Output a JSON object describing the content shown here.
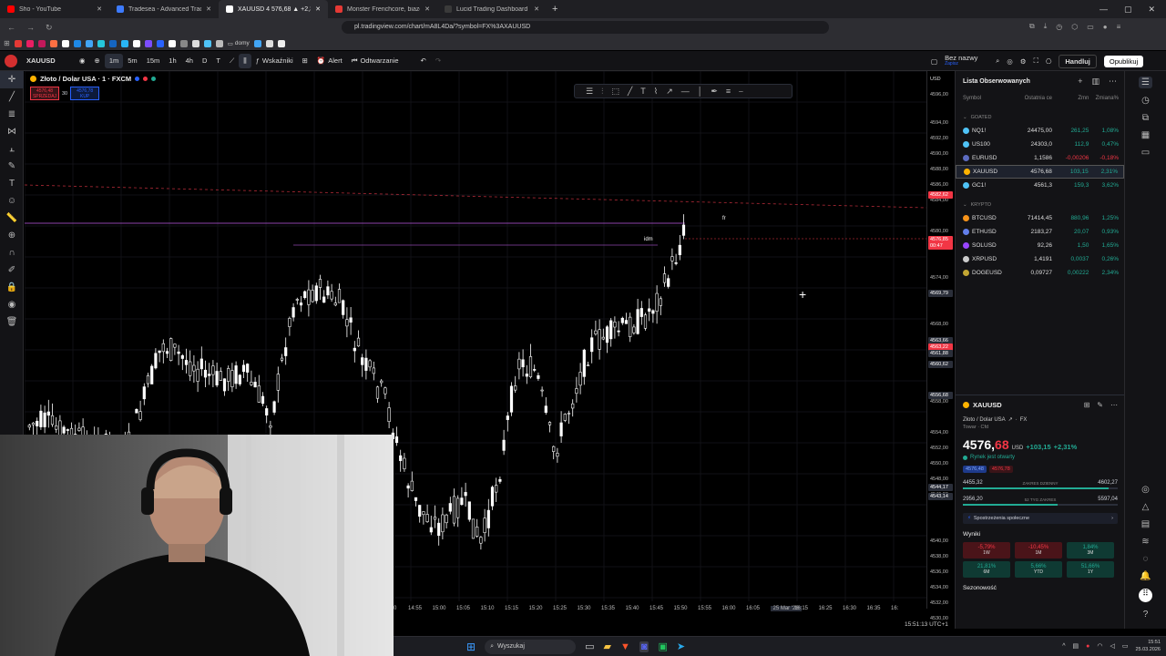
{
  "browser": {
    "tabs": [
      {
        "label": "Sho - YouTube",
        "color": "#ff0000"
      },
      {
        "label": "Tradesea - Advanced Trading Dashb",
        "color": "#3d7bff"
      },
      {
        "label": "XAUUSD 4 576,68 ▲ +2,31% Be",
        "color": "#ffffff",
        "active": true
      },
      {
        "label": "Monster Frenchcore, biazeboy",
        "color": "#e53935"
      },
      {
        "label": "Lucid Trading Dashboard",
        "color": "#3a3a3a"
      }
    ],
    "url": "pl.tradingview.com/chart/mA8L4Da/?symbol=FX%3AXAUUSD",
    "bookmark_folder": "domy"
  },
  "toolbar": {
    "symbol": "XAUUSD",
    "intervals": [
      "1m",
      "5m",
      "15m",
      "1h",
      "4h",
      "D",
      "T"
    ],
    "active_interval": "1m",
    "indicators": "Wskaźniki",
    "alert": "Alert",
    "replay": "Odtwarzanie",
    "layout_name": "Bez nazwy",
    "layout_sub": "Zapisz",
    "trade": "Handluj",
    "publish": "Opublikuj"
  },
  "chart": {
    "title": "Złoto / Dolar USA · 1 · FXCM",
    "sell_price": "4576,48",
    "sell_label": "SPRZEDAJ",
    "spread": "30",
    "buy_price": "4576,78",
    "buy_label": "KUP",
    "label_fr": "fr",
    "label_idm": "idm",
    "currency": "USD",
    "price_ticks": [
      "4596,00",
      "4594,00",
      "4592,00",
      "4590,00",
      "4588,00",
      "4586,00",
      "4584,00",
      "4580,00",
      "4578,00",
      "4574,00",
      "4572,00",
      "4568,00",
      "4566,00",
      "4558,00",
      "4554,00",
      "4552,00",
      "4550,00",
      "4548,00",
      "4546,00",
      "4540,00",
      "4538,00",
      "4536,00",
      "4534,00",
      "4532,00",
      "4530,00"
    ],
    "price_badges": [
      {
        "text": "4582,62",
        "color": "#f23645"
      },
      {
        "text": "4576,85",
        "color": "#f23645"
      },
      {
        "text": "00:47",
        "color": "#f23645"
      },
      {
        "text": "4569,79",
        "color": "#2a2e39"
      },
      {
        "text": "4563,66",
        "color": "#2a2e39"
      },
      {
        "text": "4563,22",
        "color": "#f23645"
      },
      {
        "text": "4561,88",
        "color": "#2a2e39"
      },
      {
        "text": "4560,62",
        "color": "#2a2e39"
      },
      {
        "text": "4556,68",
        "color": "#2a2e39"
      },
      {
        "text": "4544,17",
        "color": "#2a2e39"
      },
      {
        "text": "4543,14",
        "color": "#2a2e39"
      }
    ],
    "time_ticks": [
      "0",
      "14:55",
      "15:00",
      "15:05",
      "15:10",
      "15:15",
      "15:20",
      "15:25",
      "15:30",
      "15:35",
      "15:40",
      "15:45",
      "15:50",
      "15:55",
      "16:00",
      "16:05",
      "25 Mar '26",
      "16:15",
      "16:25",
      "16:30",
      "16:35",
      "16:"
    ],
    "clock": "15:51:13 UTC+1"
  },
  "watchlist": {
    "title": "Lista Obserwowanych",
    "columns": [
      "Symbol",
      "Ostatnia ce",
      "Zmn",
      "Zmiana%"
    ],
    "groups": [
      {
        "name": "GOATED",
        "rows": [
          {
            "sym": "NQ1!",
            "last": "24475,00",
            "chg": "261,25",
            "pct": "1,08%",
            "up": true,
            "color": "#4fc3f7"
          },
          {
            "sym": "US100",
            "last": "24303,0",
            "chg": "112,9",
            "pct": "0,47%",
            "up": true,
            "color": "#4fc3f7"
          },
          {
            "sym": "EURUSD",
            "last": "1,1586",
            "chg": "-0,00206",
            "pct": "-0,18%",
            "up": false,
            "color": "#5c6bc0"
          },
          {
            "sym": "XAUUSD",
            "last": "4576,68",
            "chg": "103,15",
            "pct": "2,31%",
            "up": true,
            "color": "#ffb300",
            "selected": true
          },
          {
            "sym": "GC1!",
            "last": "4561,3",
            "chg": "159,3",
            "pct": "3,62%",
            "up": true,
            "color": "#4fc3f7"
          }
        ]
      },
      {
        "name": "KRYPTO",
        "rows": [
          {
            "sym": "BTCUSD",
            "last": "71414,45",
            "chg": "880,96",
            "pct": "1,25%",
            "up": true,
            "color": "#f7931a"
          },
          {
            "sym": "ETHUSD",
            "last": "2183,27",
            "chg": "20,07",
            "pct": "0,93%",
            "up": true,
            "color": "#627eea"
          },
          {
            "sym": "SOLUSD",
            "last": "92,26",
            "chg": "1,50",
            "pct": "1,65%",
            "up": true,
            "color": "#9945ff"
          },
          {
            "sym": "XRPUSD",
            "last": "1,4191",
            "chg": "0,0037",
            "pct": "0,26%",
            "up": true,
            "color": "#cccccc"
          },
          {
            "sym": "DOGEUSD",
            "last": "0,09727",
            "chg": "0,00222",
            "pct": "2,34%",
            "up": true,
            "color": "#c2a633"
          }
        ]
      }
    ]
  },
  "details": {
    "symbol": "XAUUSD",
    "name": "Złoto / Dolar USA",
    "exchange": "FX",
    "type": "Towar · Cfd",
    "price": "4576,",
    "price_dec": "68",
    "currency": "USD",
    "change": "+103,15",
    "change_pct": "+2,31%",
    "market_status": "Rynek jest otwarty",
    "bid": "4576,48",
    "ask": "4576,78",
    "day_low": "4455,32",
    "day_high": "4602,27",
    "day_label": "ZAKRES DZIENNY",
    "day_range_pos": 0.94,
    "year_low": "2956,20",
    "year_high": "5597,04",
    "year_label": "52 TYG ZAKRES",
    "year_range_pos": 0.61,
    "community": "Spostrzeżenia społeczne",
    "results_title": "Wyniki",
    "results": [
      {
        "value": "-5,79%",
        "label": "1W",
        "up": false
      },
      {
        "value": "-10,45%",
        "label": "1M",
        "up": false
      },
      {
        "value": "1,84%",
        "label": "3M",
        "up": true
      },
      {
        "value": "21,81%",
        "label": "6M",
        "up": true
      },
      {
        "value": "5,66%",
        "label": "YTD",
        "up": true
      },
      {
        "value": "51,66%",
        "label": "1Y",
        "up": true
      }
    ],
    "season": "Sezonowość"
  },
  "taskbar": {
    "search": "Wyszukaj",
    "time": "15:51",
    "date": "25.03.2026"
  }
}
